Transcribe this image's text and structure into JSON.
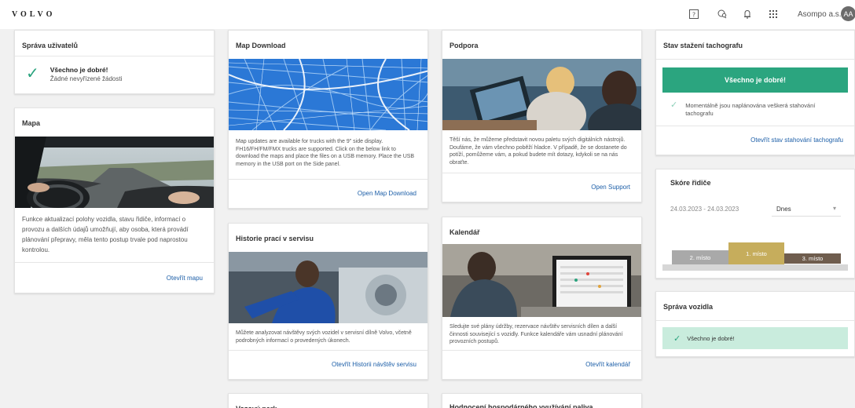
{
  "header": {
    "logo": "VOLVO",
    "icons": [
      "help-icon",
      "chat-icon",
      "bell-icon",
      "apps-grid-icon"
    ],
    "company": "Asompo a.s.",
    "avatar_initials": "AA"
  },
  "cards": {
    "users": {
      "title": "Správa uživatelů",
      "status_title": "Všechno je dobré!",
      "status_sub": "Žádné nevyřízené žádosti"
    },
    "map": {
      "title": "Mapa",
      "text": "Funkce aktualizací polohy vozidla, stavu řidiče, informací o provozu a dalších údajů umožňují, aby osoba, která provádí plánování přepravy, měla tento postup trvale pod naprostou kontrolou.",
      "link": "Otevřít mapu"
    },
    "map_download": {
      "title": "Map Download",
      "text": "Map updates are available for trucks with the 9\" side display. FH16/FH/FM/FMX trucks are supported. Click on the below link to download the maps and place the files on a USB memory. Place the USB memory in the USB port on the Side panel.",
      "link": "Open Map Download"
    },
    "support": {
      "title": "Podpora",
      "text": "Těší nás, že můžeme představit novou paletu svých digitálních nástrojů. Doufáme, že vám všechno poběží hladce. V případě, že se dostanete do potíží, pomůžeme vám, a pokud budete mít dotazy, kdykoli se na nás obraťte.",
      "link": "Open Support"
    },
    "service_history": {
      "title": "Historie prací v servisu",
      "text": "Můžete analyzovat návštěvy svých vozidel v servisní dílně Volvo, včetně podrobných informací o provedených úkonech.",
      "link": "Otevřít Historii návštěv servisu"
    },
    "calendar": {
      "title": "Kalendář",
      "text": "Sledujte své plány údržby, rezervace návštěv servisních dílen a další činnosti související s vozidly. Funkce kalendáře vám usnadní plánování provozních postupů.",
      "link": "Otevřít kalendář"
    },
    "tacho": {
      "title": "Stav stažení tachografu",
      "button": "Všechno je dobré!",
      "message": "Momentálně jsou naplánována veškerá stahování tachografu",
      "link": "Otevřít stav stahování tachografu"
    },
    "score": {
      "title": "Skóre řidiče",
      "dates": "24.03.2023 - 24.03.2023",
      "select_value": "Dnes",
      "podium": [
        {
          "label": "2. místo",
          "color": "#a9a9a9"
        },
        {
          "label": "1. místo",
          "color": "#c6ad5c"
        },
        {
          "label": "3. místo",
          "color": "#6f5d4e"
        }
      ]
    },
    "vehicle": {
      "title": "Správa vozidla",
      "status": "Všechno je dobré!"
    },
    "bottom_left": {
      "title": "Vozový park"
    },
    "bottom_right": {
      "title": "Hodnocení hospodárného využívání paliva"
    }
  },
  "colors": {
    "accent_green": "#2ba57f",
    "link_blue": "#1d5fa8",
    "map_blue": "#2b78d6"
  }
}
